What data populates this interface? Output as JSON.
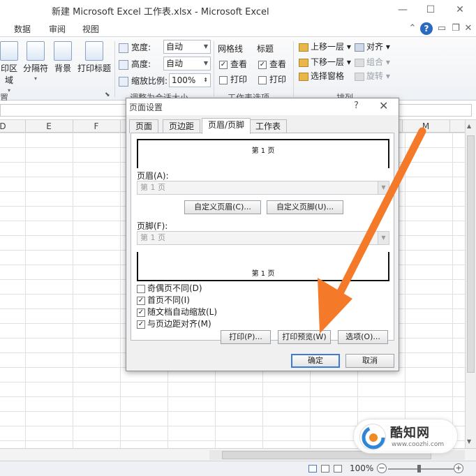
{
  "window": {
    "title": "新建 Microsoft Excel 工作表.xlsx - Microsoft Excel"
  },
  "menu": {
    "items": [
      "数据",
      "审阅",
      "视图"
    ]
  },
  "ribbon": {
    "print_area": "印区域",
    "breaks": "分隔符",
    "background": "背景",
    "print_titles": "打印标题",
    "setup_group": "置",
    "width_label": "宽度:",
    "width_value": "自动",
    "height_label": "高度:",
    "height_value": "自动",
    "scale_label": "缩放比例:",
    "scale_value": "100%",
    "fit_group": "调整为合适大小",
    "gridlines_title": "网格线",
    "gridlines_view": "查看",
    "gridlines_print": "打印",
    "headings_title": "标题",
    "headings_view": "查看",
    "headings_print": "打印",
    "sheet_options_group": "工作表选项",
    "bring_forward": "上移一层",
    "send_backward": "下移一层",
    "selection_pane": "选择窗格",
    "align": "对齐",
    "group": "组合",
    "rotate": "旋转",
    "arrange_group": "排列"
  },
  "columns": [
    "D",
    "E",
    "F",
    "M"
  ],
  "dialog": {
    "title": "页面设置",
    "help": "?",
    "close": "✕",
    "tabs": [
      "页面",
      "页边距",
      "页眉/页脚",
      "工作表"
    ],
    "header_preview": "第 1 页",
    "header_label": "页眉(A):",
    "header_value": "第 1 页",
    "custom_header": "自定义页眉(C)...",
    "custom_footer": "自定义页脚(U)...",
    "footer_label": "页脚(F):",
    "footer_value": "第 1 页",
    "footer_preview": "第 1 页",
    "odd_even": "奇偶页不同(D)",
    "first_page": "首页不同(I)",
    "scale_with_doc": "随文档自动缩放(L)",
    "align_margins": "与页边距对齐(M)",
    "print_btn": "打印(P)...",
    "print_preview_btn": "打印预览(W)",
    "options_btn": "选项(O)...",
    "ok_btn": "确定",
    "cancel_btn": "取消"
  },
  "status": {
    "zoom": "100%"
  },
  "watermark": {
    "name": "酷知网",
    "url": "www.coozhi.com"
  },
  "colors": {
    "arrow": "#f47a2a",
    "accent": "#3b7bd4"
  }
}
